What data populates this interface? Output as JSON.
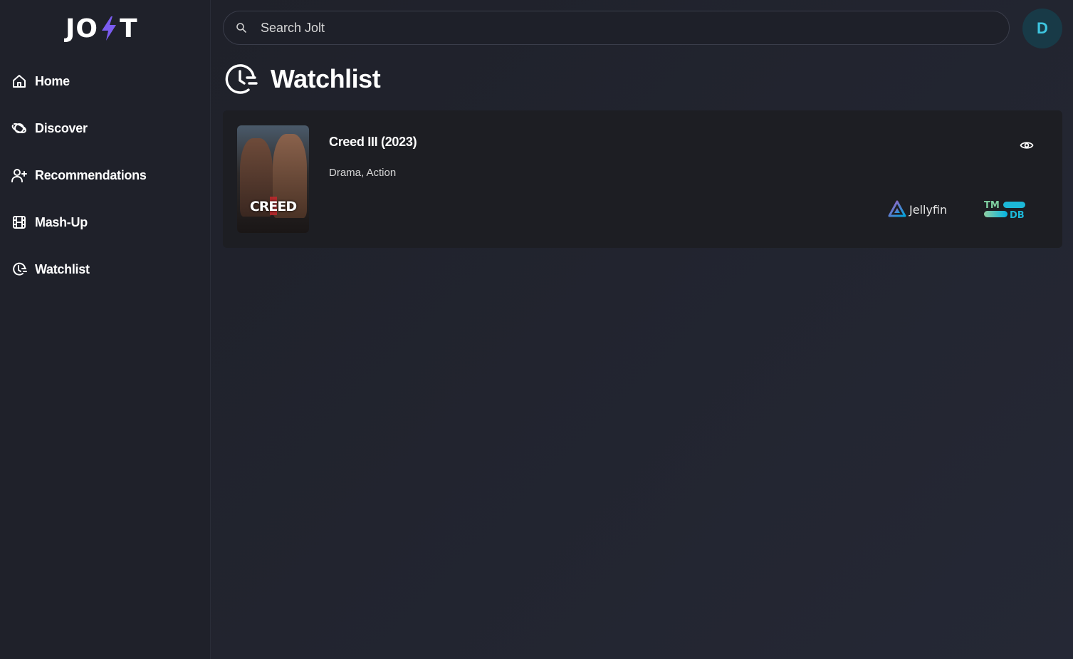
{
  "app": {
    "logo_left": "JO",
    "logo_right": "T",
    "brand_color": "#7b5cf0"
  },
  "sidebar": {
    "items": [
      {
        "label": "Home",
        "icon": "home-icon"
      },
      {
        "label": "Discover",
        "icon": "planet-icon"
      },
      {
        "label": "Recommendations",
        "icon": "user-plus-icon"
      },
      {
        "label": "Mash-Up",
        "icon": "film-icon"
      },
      {
        "label": "Watchlist",
        "icon": "watchlist-clock-icon"
      }
    ]
  },
  "header": {
    "search": {
      "placeholder": "Search Jolt",
      "value": ""
    },
    "avatar_initial": "D",
    "avatar_color": "#183a47",
    "avatar_text_color": "#3ec6e0"
  },
  "page": {
    "title": "Watchlist",
    "icon": "watchlist-clock-icon"
  },
  "watchlist": {
    "items": [
      {
        "title": "Creed III (2023)",
        "genres": "Drama, Action",
        "poster_text": "CREED",
        "providers": [
          {
            "name": "Jellyfin",
            "icon": "jellyfin-icon"
          },
          {
            "name": "TMDB",
            "icon": "tmdb-icon"
          }
        ],
        "action_icon": "eye-icon"
      }
    ]
  }
}
